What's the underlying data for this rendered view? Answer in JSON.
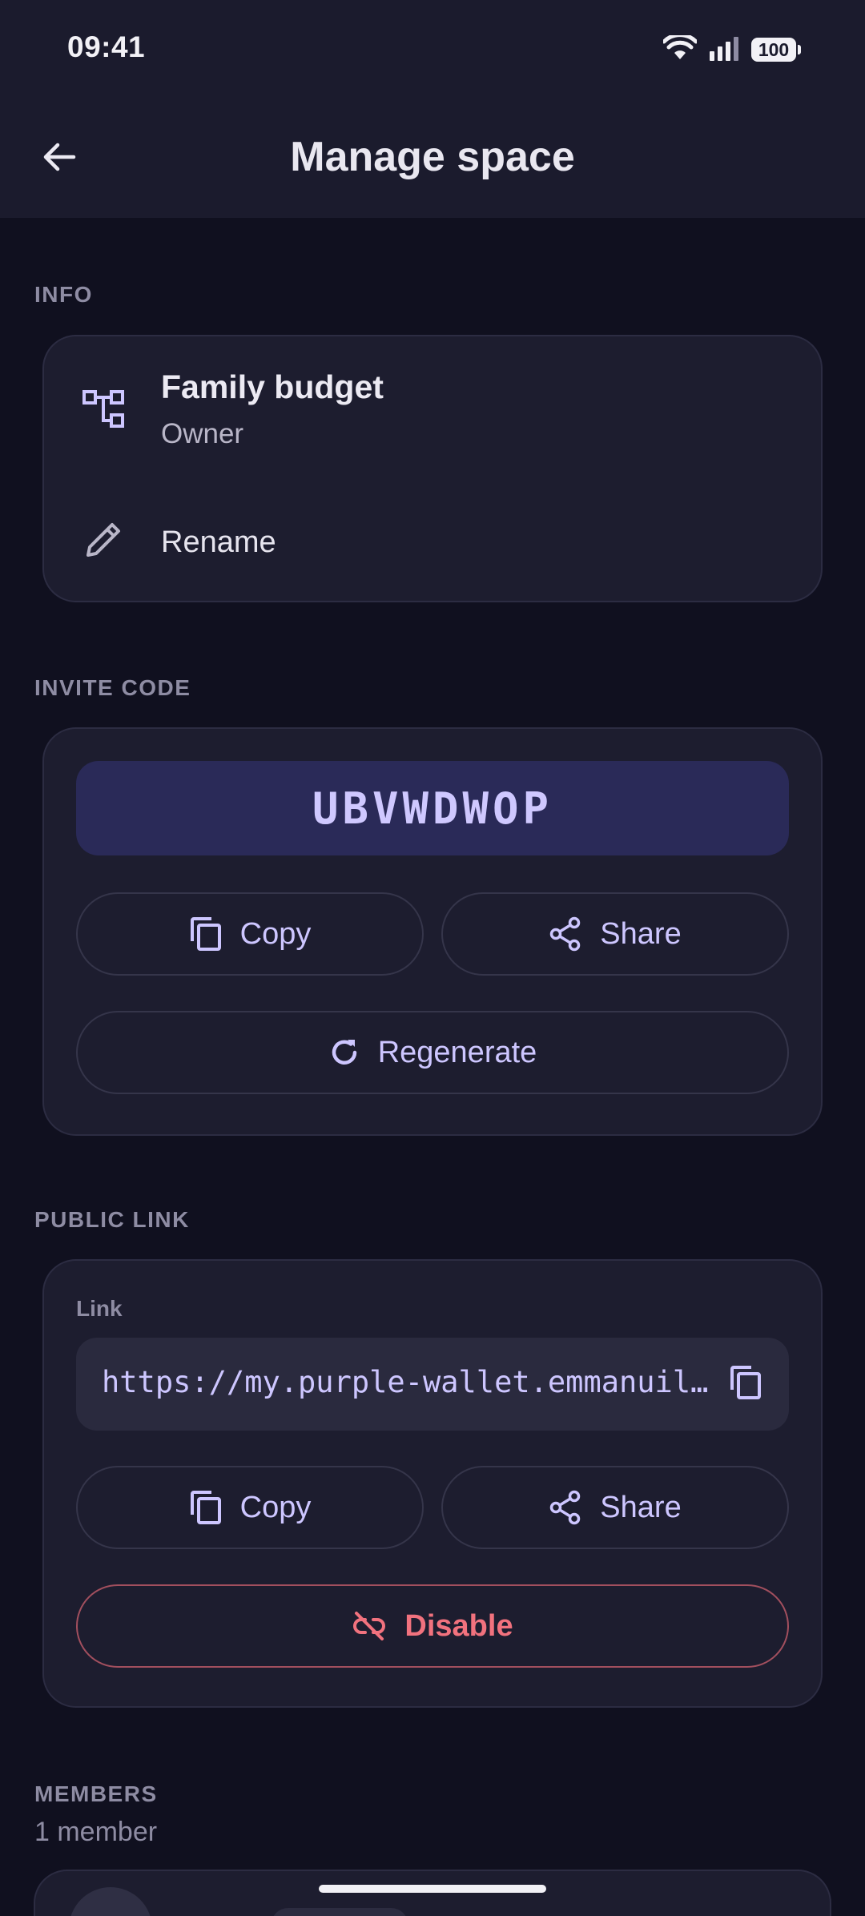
{
  "status_bar": {
    "time": "09:41",
    "battery": "100"
  },
  "app_bar": {
    "title": "Manage space",
    "back_icon": "arrow-left-icon"
  },
  "info": {
    "section_label": "INFO",
    "space_name": "Family budget",
    "role": "Owner",
    "rename_label": "Rename"
  },
  "invite_code": {
    "section_label": "INVITE CODE",
    "code": "UBVWDWOP",
    "copy_label": "Copy",
    "share_label": "Share",
    "regenerate_label": "Regenerate"
  },
  "public_link": {
    "section_label": "PUBLIC LINK",
    "field_label": "Link",
    "url": "https://my.purple-wallet.emmanuil…",
    "copy_label": "Copy",
    "share_label": "Share",
    "disable_label": "Disable"
  },
  "members": {
    "section_label": "MEMBERS",
    "count_label": "1 member"
  },
  "colors": {
    "accent": "#cdc6ff",
    "danger": "#f1727e",
    "background": "#10101f",
    "card": "#1d1d2f",
    "code_box": "#2a2a58"
  }
}
